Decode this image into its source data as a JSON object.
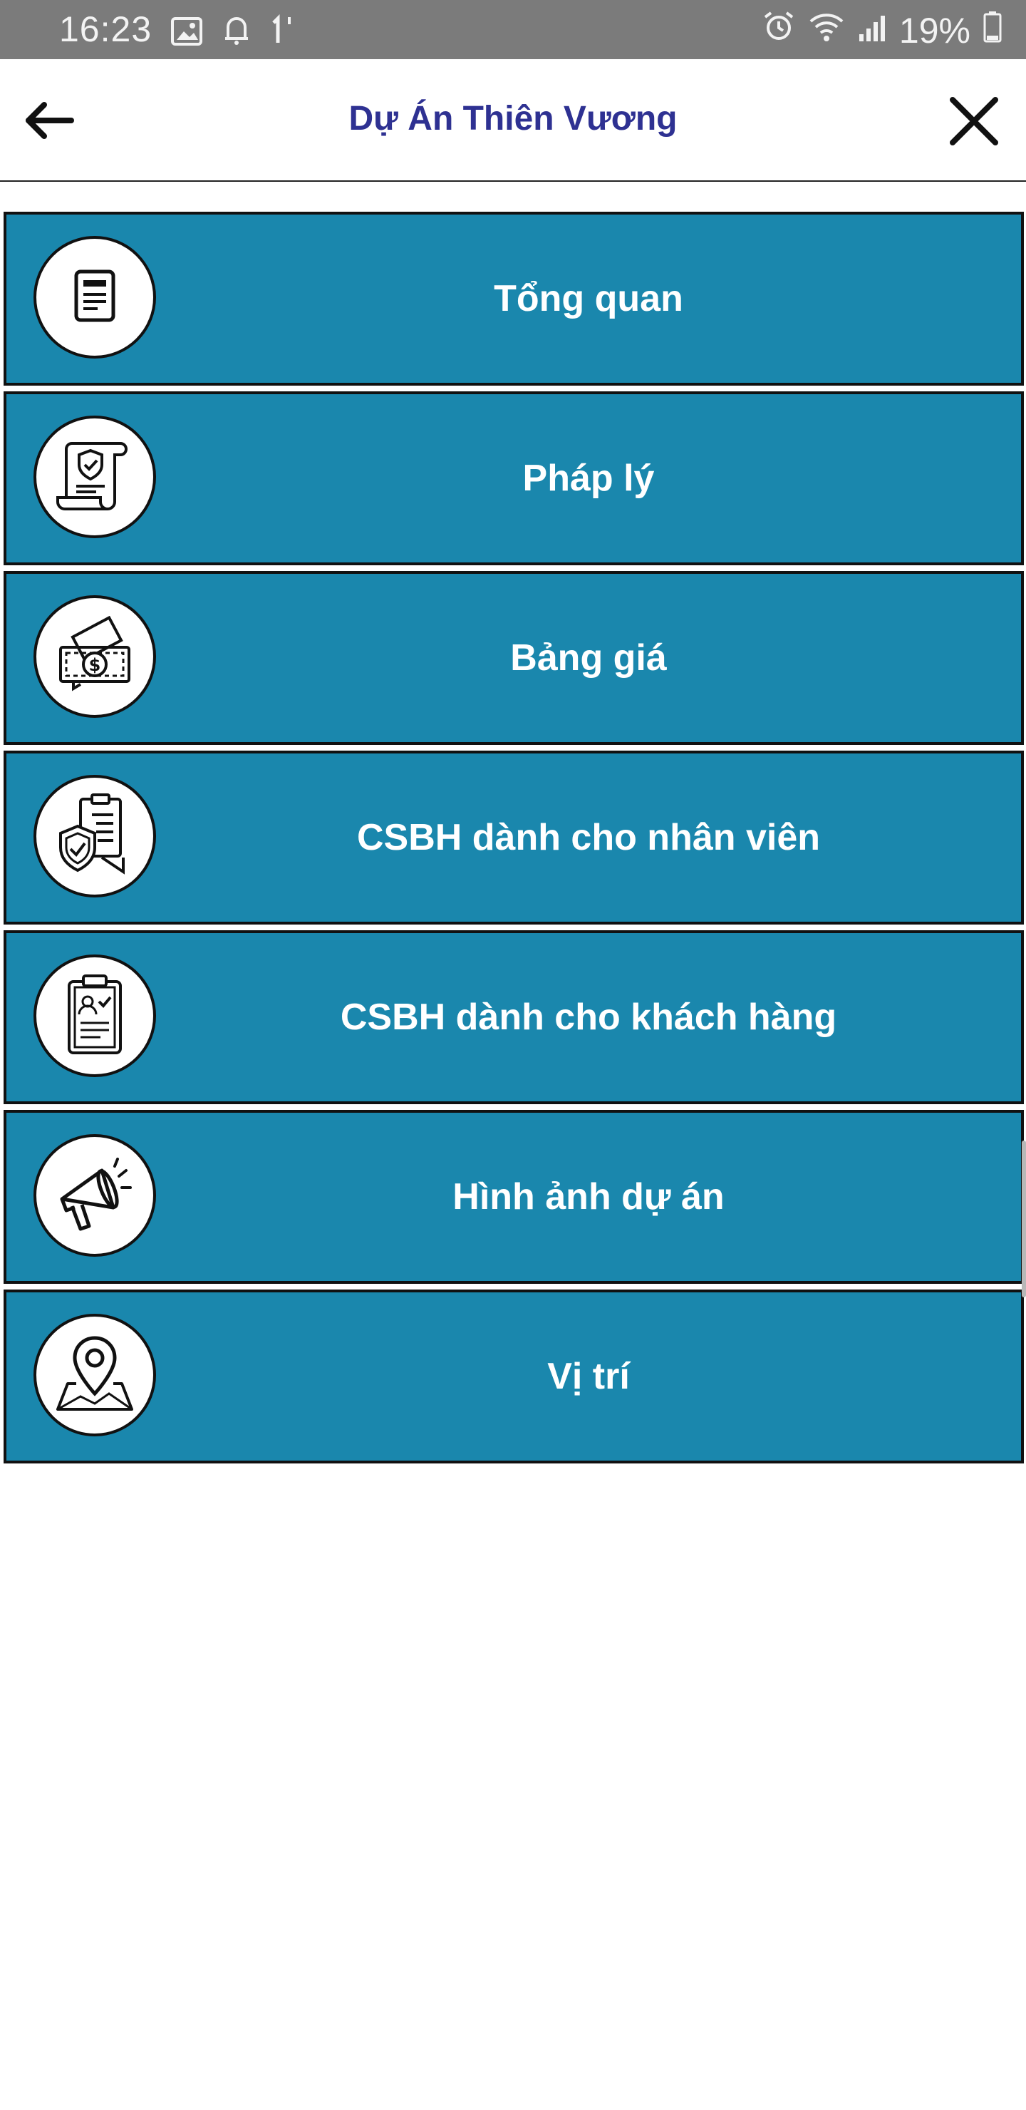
{
  "status_bar": {
    "time": "16:23",
    "battery_text": "19%",
    "left_icons": [
      "gallery-icon",
      "bell-icon",
      "data-icon"
    ],
    "right_icons": [
      "alarm-icon",
      "wifi-icon",
      "signal-icon",
      "battery-icon"
    ]
  },
  "header": {
    "title": "Dự Án Thiên Vương",
    "back_icon": "arrow-left-icon",
    "close_icon": "close-icon",
    "title_color": "#2e3192"
  },
  "menu": {
    "accent": "#1a87ad",
    "items": [
      {
        "label": "Tổng quan",
        "icon": "document-icon"
      },
      {
        "label": "Pháp lý",
        "icon": "legal-scroll-icon"
      },
      {
        "label": "Bảng giá",
        "icon": "money-icon"
      },
      {
        "label": "CSBH dành cho nhân viên",
        "icon": "policy-shield-icon"
      },
      {
        "label": "CSBH dành cho khách hàng",
        "icon": "customer-clipboard-icon"
      },
      {
        "label": "Hình ảnh dự án",
        "icon": "megaphone-icon"
      },
      {
        "label": "Vị trí",
        "icon": "map-pin-icon"
      }
    ]
  }
}
